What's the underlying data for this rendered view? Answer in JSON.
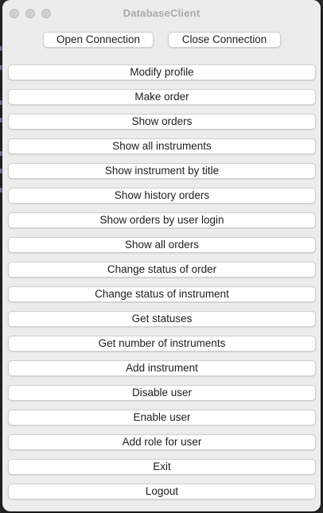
{
  "window": {
    "title": "DatabaseClient"
  },
  "connection": {
    "open_label": "Open Connection",
    "close_label": "Close Connection"
  },
  "menu": {
    "items": [
      {
        "label": "Modify profile"
      },
      {
        "label": "Make order"
      },
      {
        "label": "Show orders"
      },
      {
        "label": "Show all instruments"
      },
      {
        "label": "Show instrument by title"
      },
      {
        "label": "Show history orders"
      },
      {
        "label": "Show orders by user login"
      },
      {
        "label": "Show all orders"
      },
      {
        "label": "Change status of order"
      },
      {
        "label": "Change status of instrument"
      },
      {
        "label": "Get statuses"
      },
      {
        "label": "Get number of instruments"
      },
      {
        "label": "Add instrument"
      },
      {
        "label": "Disable user"
      },
      {
        "label": "Enable user"
      },
      {
        "label": "Add role for user"
      },
      {
        "label": "Exit"
      },
      {
        "label": "Logout"
      }
    ]
  }
}
